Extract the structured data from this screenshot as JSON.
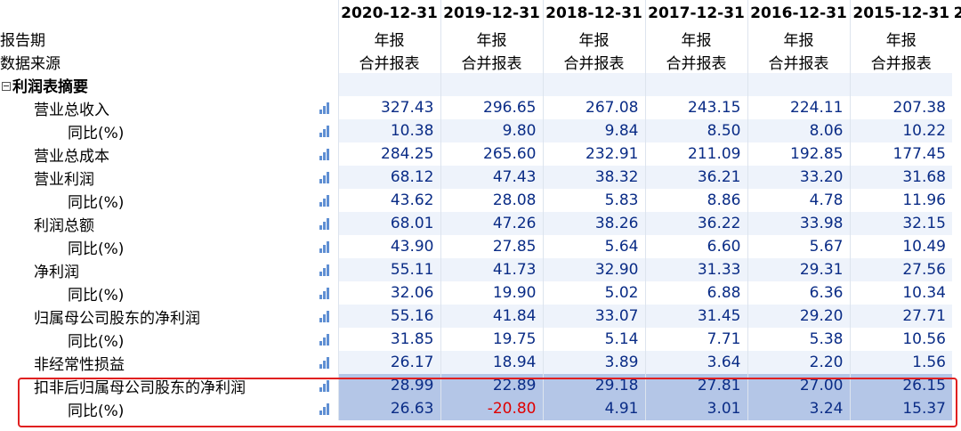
{
  "header": {
    "dates": [
      "2020-12-31",
      "2019-12-31",
      "2018-12-31",
      "2017-12-31",
      "2016-12-31",
      "2015-12-31"
    ],
    "trailing_glyph": "2"
  },
  "report_period": {
    "label": "报告期",
    "values": [
      "年报",
      "年报",
      "年报",
      "年报",
      "年报",
      "年报"
    ]
  },
  "data_source": {
    "label": "数据来源",
    "values": [
      "合并报表",
      "合并报表",
      "合并报表",
      "合并报表",
      "合并报表",
      "合并报表"
    ]
  },
  "section": {
    "title": "利润表摘要",
    "collapse_icon": "minus-box-icon"
  },
  "rows": [
    {
      "label": "营业总收入",
      "values": [
        "327.43",
        "296.65",
        "267.08",
        "243.15",
        "224.11",
        "207.38"
      ]
    },
    {
      "label": "同比(%)",
      "values": [
        "10.38",
        "9.80",
        "9.84",
        "8.50",
        "8.06",
        "10.22"
      ]
    },
    {
      "label": "营业总成本",
      "values": [
        "284.25",
        "265.60",
        "232.91",
        "211.09",
        "192.85",
        "177.45"
      ]
    },
    {
      "label": "营业利润",
      "values": [
        "68.12",
        "47.43",
        "38.32",
        "36.21",
        "33.20",
        "31.68"
      ]
    },
    {
      "label": "同比(%)",
      "values": [
        "43.62",
        "28.08",
        "5.83",
        "8.86",
        "4.78",
        "11.96"
      ]
    },
    {
      "label": "利润总额",
      "values": [
        "68.01",
        "47.26",
        "38.26",
        "36.22",
        "33.98",
        "32.15"
      ]
    },
    {
      "label": "同比(%)",
      "values": [
        "43.90",
        "27.85",
        "5.64",
        "6.60",
        "5.67",
        "10.49"
      ]
    },
    {
      "label": "净利润",
      "values": [
        "55.11",
        "41.73",
        "32.90",
        "31.33",
        "29.31",
        "27.56"
      ]
    },
    {
      "label": "同比(%)",
      "values": [
        "32.06",
        "19.90",
        "5.02",
        "6.88",
        "6.36",
        "10.34"
      ]
    },
    {
      "label": "归属母公司股东的净利润",
      "values": [
        "55.16",
        "41.84",
        "33.07",
        "31.45",
        "29.20",
        "27.71"
      ]
    },
    {
      "label": "同比(%)",
      "values": [
        "31.85",
        "19.75",
        "5.14",
        "7.71",
        "5.38",
        "10.56"
      ]
    },
    {
      "label": "非经常性损益",
      "values": [
        "26.17",
        "18.94",
        "3.89",
        "3.64",
        "2.20",
        "1.56"
      ]
    },
    {
      "label": "扣非后归属母公司股东的净利润",
      "values": [
        "28.99",
        "22.89",
        "29.18",
        "27.81",
        "27.00",
        "26.15"
      ]
    },
    {
      "label": "同比(%)",
      "values": [
        "26.63",
        "-20.80",
        "4.91",
        "3.01",
        "3.24",
        "15.37"
      ]
    }
  ],
  "chart_icon": "bar-chart-icon",
  "colors": {
    "number": "#0a2c86",
    "negative": "#e00000",
    "highlight_row": "#b4c6e7",
    "highlight_frame": "#e02020"
  }
}
